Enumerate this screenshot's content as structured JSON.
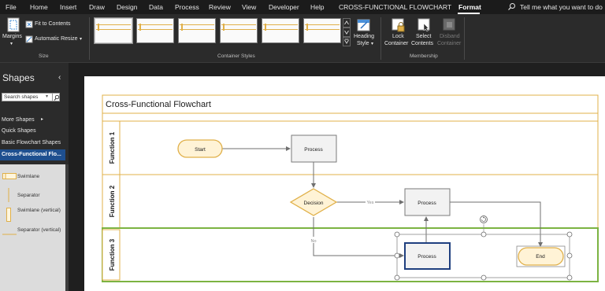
{
  "menu": {
    "items": [
      "File",
      "Home",
      "Insert",
      "Draw",
      "Design",
      "Data",
      "Process",
      "Review",
      "View",
      "Developer",
      "Help",
      "CROSS-FUNCTIONAL FLOWCHART",
      "Format"
    ],
    "active": "Format",
    "tell_me": "Tell me what you want to do"
  },
  "ribbon": {
    "size_group": {
      "label": "Size",
      "margins": "Margins",
      "fit_to_contents": "Fit to Contents",
      "automatic_resize": "Automatic Resize"
    },
    "container_styles_group": {
      "label": "Container Styles",
      "heading_style_line1": "Heading",
      "heading_style_line2": "Style"
    },
    "membership_group": {
      "label": "Membership",
      "lock_container_line1": "Lock",
      "lock_container_line2": "Container",
      "select_contents_line1": "Select",
      "select_contents_line2": "Contents",
      "disband_container_line1": "Disband",
      "disband_container_line2": "Container"
    }
  },
  "shapes_panel": {
    "title": "Shapes",
    "search_placeholder": "Search shapes",
    "more_shapes": "More Shapes",
    "quick_shapes": "Quick Shapes",
    "basic_flowchart": "Basic Flowchart Shapes",
    "active_stencil": "Cross-Functional Flo...",
    "stencil_items": [
      "Swimlane",
      "Separator",
      "Swimlane (vertical)",
      "Separator (vertical)"
    ]
  },
  "diagram": {
    "title": "Cross-Functional Flowchart",
    "lanes": [
      "Function 1",
      "Function 2",
      "Function 3"
    ],
    "shapes": {
      "start": "Start",
      "process_1": "Process",
      "decision": "Decision",
      "process_2": "Process",
      "process_3": "Process",
      "end": "End"
    },
    "connector_labels": {
      "yes": "Yes",
      "no": "No"
    }
  },
  "colors": {
    "accent": "#e0b049",
    "selection": "#7cb342",
    "active_stencil": "#1e4f8f",
    "selected_shape_border": "#1f3f7f"
  }
}
